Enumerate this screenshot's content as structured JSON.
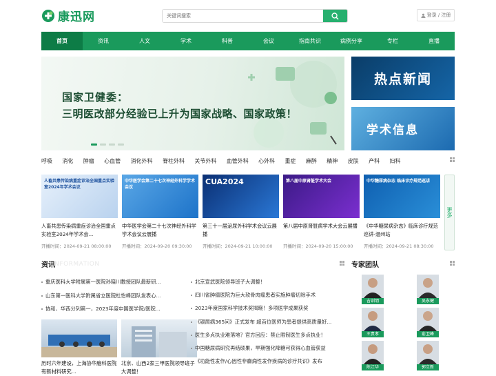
{
  "brand": {
    "name": "康迅网"
  },
  "search": {
    "placeholder": "关键词搜索"
  },
  "login": {
    "label": "登录 / 注册"
  },
  "nav": [
    "首页",
    "资讯",
    "人文",
    "学术",
    "科普",
    "会议",
    "指南共识",
    "病例分享",
    "专栏",
    "直播"
  ],
  "banner": {
    "line1": "国家卫健委：",
    "line2": "三明医改部分经验已上升为国家战略、国家政策！"
  },
  "side_banners": [
    "热点新闻",
    "学术信息"
  ],
  "categories": [
    "呼吸",
    "消化",
    "肿瘤",
    "心血管",
    "消化外科",
    "脊柱外科",
    "关节外科",
    "血管外科",
    "心外科",
    "重症",
    "麻醉",
    "精神",
    "皮肤",
    "产科",
    "妇科"
  ],
  "lives": [
    {
      "thumb_title": "人畜共患传染病重症诊治全国重点实验室2024年学术会议",
      "caption": "人畜共患传染病重症诊治全国重点实验室2024年学术会...",
      "time": "开播时间：2024-09-21 08:00:00"
    },
    {
      "thumb_title": "中华医学会第二十七次神经外科学学术会议",
      "caption": "中华医学会第二十七次神经外科学学术会议云展播",
      "time": "开播时间：2024-09-20 09:30:00"
    },
    {
      "thumb_title": "CUA2024",
      "caption": "第三十一届泌尿外科学术会议云展播",
      "time": "开播时间：2024-09-21 10:00:00"
    },
    {
      "thumb_title": "第八届中原肾脏学术大会",
      "caption": "第八届中原肾脏病学术大会云展播",
      "time": "开播时间：2024-09-20 15:00:00"
    },
    {
      "thumb_title": "中华糖尿病杂志 临床诊疗规范巡讲",
      "caption": "《中华糖尿病杂志》临床诊疗规范巡讲-温州站",
      "time": "开播时间：2024-09-21 08:30:00"
    }
  ],
  "more_label": "更多",
  "news_section": {
    "title": "资讯",
    "bg": "INFORMATION"
  },
  "news_left": [
    "重庆医科大学附属第一医院孙晓川教授团队最新研...",
    "山东第一医科大学附属省立医院杜怡峰团队发表心...",
    "协和、华西分列第一，2023年度中国医学院/医院..."
  ],
  "news_right": [
    "北京宣武医院领导班子大调整！",
    "四川省肿瘤医院为巨大软骨肉瘤患者实施肿瘤切除手术",
    "2023年度国家科学技术奖揭晓！多项医学成果获奖",
    "《银屑病365问》正式发布 超百位医师为患者提供高质量好...",
    "医生多点执业难落地？官方回应：禁止限制医生多点执业！",
    "中国糖尿病研究再结硕果，早期强化降糖可获得心血管获益",
    "《功能性发作/心因性非癫痫性发作疾病的诊疗共识》发布"
  ],
  "pics": [
    {
      "caption": "历时六年建设，上海协华脑科医院有新材料研究..."
    },
    {
      "caption": "北京、山西2家三甲医院领导班子大调整！"
    }
  ],
  "experts_section": {
    "title": "专家团队"
  },
  "experts": [
    "吉训明",
    "吴永健",
    "王贵孝",
    "俞卫峰",
    "陈江华",
    "郭立新"
  ],
  "colors": {
    "brand_green": "#1a9a5c",
    "accent_green": "#27b06f"
  }
}
